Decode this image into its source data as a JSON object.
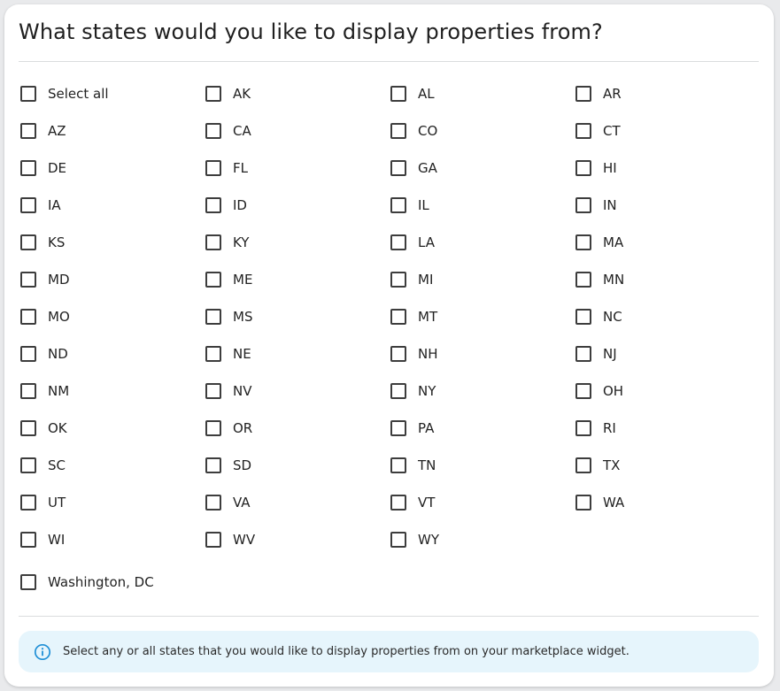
{
  "dialog": {
    "title": "What states would you like to display properties from?",
    "options": [
      "Select all",
      "AK",
      "AL",
      "AR",
      "AZ",
      "CA",
      "CO",
      "CT",
      "DE",
      "FL",
      "GA",
      "HI",
      "IA",
      "ID",
      "IL",
      "IN",
      "KS",
      "KY",
      "LA",
      "MA",
      "MD",
      "ME",
      "MI",
      "MN",
      "MO",
      "MS",
      "MT",
      "NC",
      "ND",
      "NE",
      "NH",
      "NJ",
      "NM",
      "NV",
      "NY",
      "OH",
      "OK",
      "OR",
      "PA",
      "RI",
      "SC",
      "SD",
      "TN",
      "TX",
      "UT",
      "VA",
      "VT",
      "WA",
      "WI",
      "WV",
      "WY"
    ],
    "dc_option": "Washington, DC",
    "info": {
      "icon": "info-icon",
      "text": "Select any or all states that you would like to display properties from on your marketplace widget."
    }
  },
  "colors": {
    "info_background": "#e6f5fc",
    "info_icon": "#1f8fd6",
    "checkbox_border": "#3d3d3d"
  }
}
